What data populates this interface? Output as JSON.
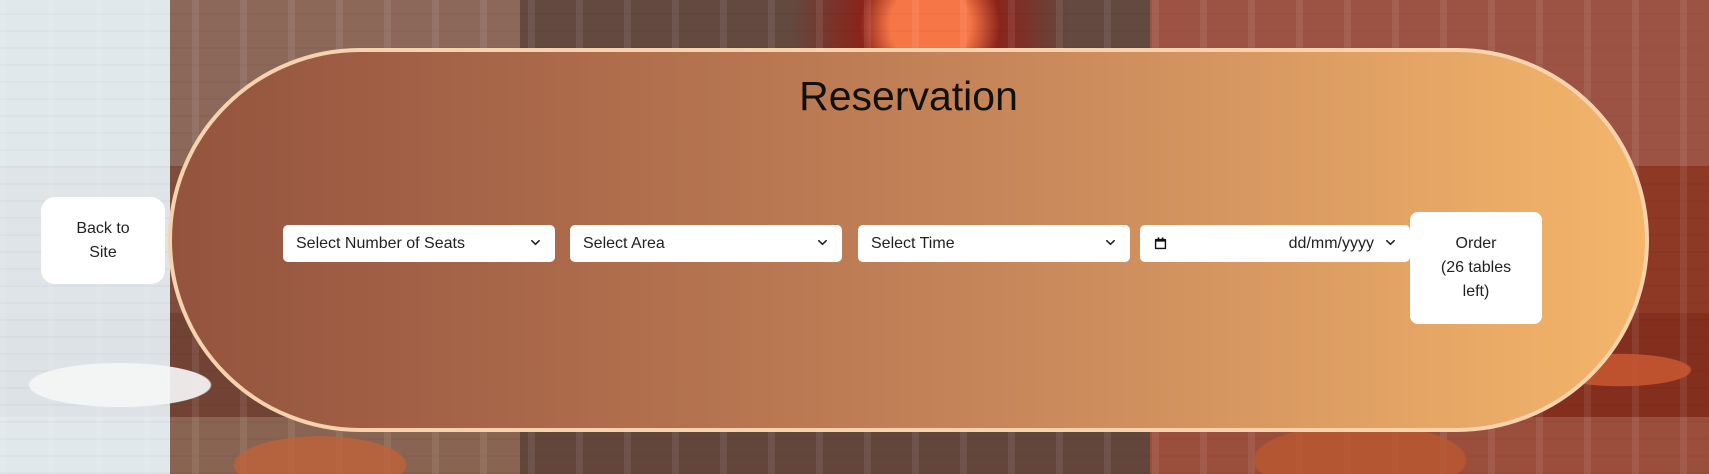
{
  "page": {
    "title": "Reservation"
  },
  "nav": {
    "back_label": "Back to\nSite"
  },
  "form": {
    "seats_label": "Select Number of Seats",
    "area_label": "Select Area",
    "time_label": "Select Time",
    "date_placeholder": "dd/mm/yyyy",
    "order_label": "Order\n(26 tables\nleft)"
  },
  "icons": {
    "chevron": "chevron-down-icon",
    "calendar": "calendar-icon"
  },
  "colors": {
    "card_start": "#93533e",
    "card_end": "#f4b66b",
    "card_border": "#f6d3ad",
    "button_bg": "#ffffff",
    "text": "#111111"
  }
}
